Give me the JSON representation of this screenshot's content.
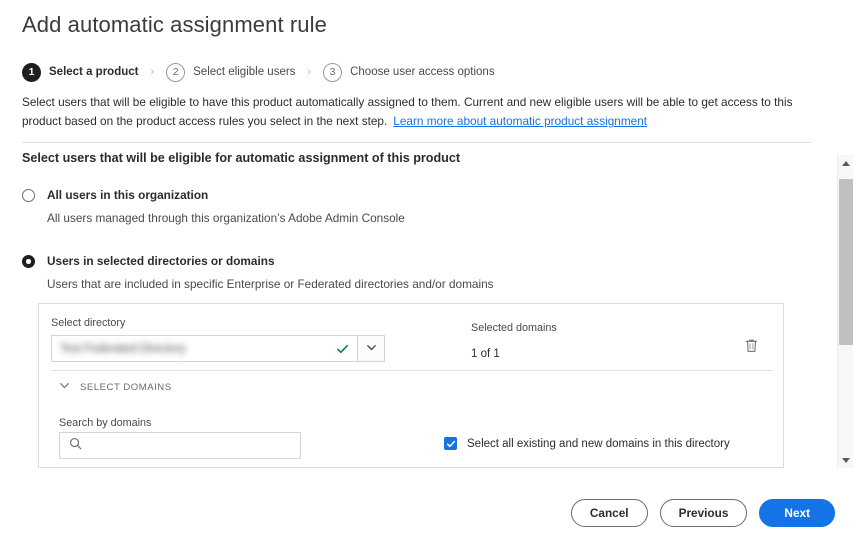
{
  "page": {
    "title": "Add automatic assignment rule"
  },
  "stepper": {
    "separator": "›",
    "steps": [
      {
        "number": "1",
        "label": "Select a product",
        "state": "active"
      },
      {
        "number": "2",
        "label": "Select eligible users",
        "state": "inactive"
      },
      {
        "number": "3",
        "label": "Choose user access options",
        "state": "inactive"
      }
    ]
  },
  "intro": {
    "text": "Select users that will be eligible to have this product automatically assigned to them. Current and new eligible users will be able to get access to this product based on the product access rules you select in the next step.",
    "link_text": "Learn more about automatic product assignment",
    "link_color": "#1473e6"
  },
  "section": {
    "heading": "Select users that will be eligible for automatic assignment of this product"
  },
  "radios": [
    {
      "label": "All users in this organization",
      "description": "All users managed through this organization’s Adobe Admin Console",
      "selected": false
    },
    {
      "label": "Users in selected directories or domains",
      "description": "Users that are included in specific Enterprise or Federated directories and/or domains",
      "selected": true
    }
  ],
  "directory_card": {
    "select_directory_label": "Select directory",
    "directory_value": "Test Federated Directory",
    "directory_value_redacted": true,
    "valid_icon": "check-icon",
    "valid_icon_color": "#0d7d4d",
    "dropdown_icon": "chevron-down-icon",
    "delete_icon": "trash-icon",
    "selected_domains_label": "Selected domains",
    "selected_domains_count": "1 of 1",
    "select_domains_toggle_label": "SELECT DOMAINS",
    "select_domains_toggle_icon": "chevron-down-icon",
    "search_label": "Search by domains",
    "search_icon": "search-icon",
    "search_value": "",
    "search_placeholder": "",
    "select_all_label": "Select all existing and new domains in this directory",
    "select_all_checked": true,
    "checkbox_color": "#1473e6"
  },
  "scrollbar": {
    "up_icon": "triangle-up-icon",
    "down_icon": "triangle-down-icon"
  },
  "footer": {
    "cancel_label": "Cancel",
    "previous_label": "Previous",
    "next_label": "Next",
    "primary_color": "#1473e6"
  }
}
